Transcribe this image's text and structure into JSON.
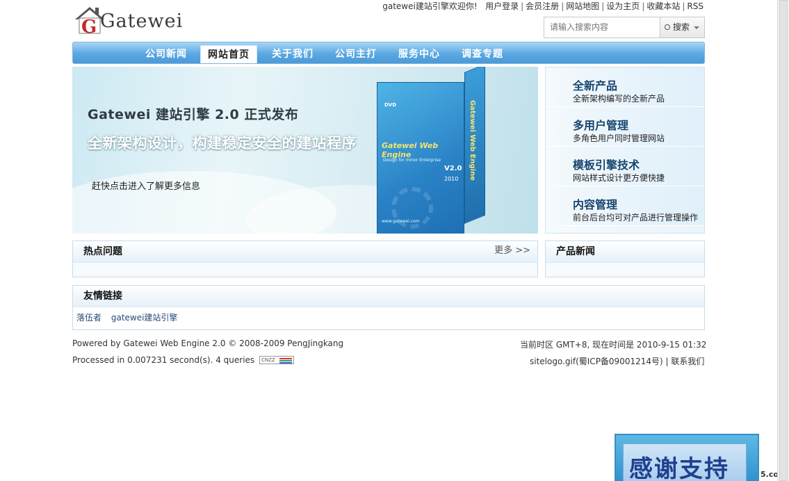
{
  "header": {
    "logo_text": "Gatewei",
    "welcome": "gatewei建站引擎欢迎你!",
    "links": [
      "用户登录",
      "会员注册",
      "网站地图",
      "设为主页",
      "收藏本站",
      "RSS"
    ]
  },
  "search": {
    "placeholder": "请输入搜索内容",
    "button": "搜索"
  },
  "menu": {
    "items": [
      "公司新闻",
      "网站首页",
      "关于我们",
      "公司主打",
      "服务中心",
      "调查专题"
    ],
    "active": "网站首页"
  },
  "banner": {
    "title": "Gatewei 建站引擎 2.0 正式发布",
    "subtitle": "全新架构设计，构建稳定安全的建站程序",
    "cta": "赶快点击进入了解更多信息",
    "box": {
      "dvd": "DVD",
      "brand": "Gatewei Web Engine",
      "tagline": "Design for minor Enterprise",
      "version": "V2.0",
      "year": "2010",
      "url": "www.gatewei.com",
      "side": "Gatewei Web Engine"
    }
  },
  "features": [
    {
      "title": "全新产品",
      "desc": "全新架构编写的全新产品"
    },
    {
      "title": "多用户管理",
      "desc": "多角色用户同时管理网站"
    },
    {
      "title": "模板引擎技术",
      "desc": "网站样式设计更方便快捷"
    },
    {
      "title": "内容管理",
      "desc": "前台后台均可对产品进行管理操作"
    }
  ],
  "hot": {
    "title": "热点问题",
    "more": "更多 >>"
  },
  "product_news": {
    "title": "产品新闻"
  },
  "friend_links": {
    "title": "友情链接",
    "items": [
      "落伍者",
      "gatewei建站引擎"
    ]
  },
  "footer": {
    "powered": "Powered by Gatewei Web Engine 2.0 © 2008-2009 PengJingkang",
    "processed": "Processed in 0.007231 second(s). 4 queries",
    "badge": "CNZZ",
    "timezone": "当前时区  GMT+8, 现在时间是  2010-9-15 01:32",
    "icp": "sitelogo.gif(蜀ICP备09001214号)",
    "contact": "联系我们"
  },
  "thanks_banner": "感谢支持",
  "watermark": "5.com",
  "colors": {
    "menu_blue": "#5aa8e2",
    "feature_title": "#17456e",
    "panel_border": "#c5dced"
  }
}
